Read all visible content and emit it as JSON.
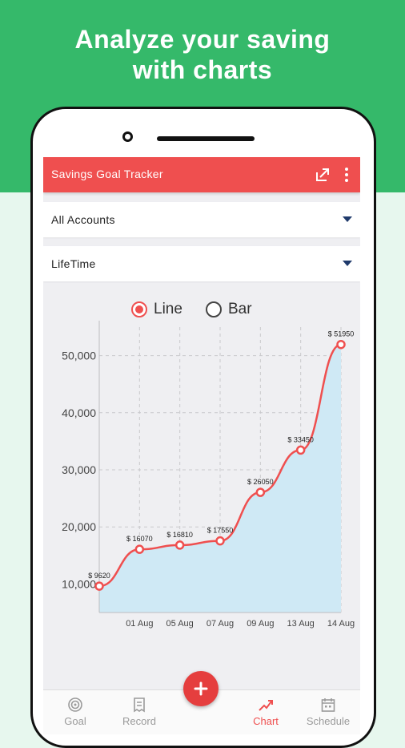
{
  "hero": {
    "line1": "Analyze your saving",
    "line2": "with charts"
  },
  "app_bar": {
    "title": "Savings Goal Tracker",
    "share_icon": "share-icon",
    "menu_icon": "more-vert-icon"
  },
  "filters": {
    "account": {
      "value": "All Accounts",
      "icon": "dropdown-arrow-icon"
    },
    "period": {
      "value": "LifeTime",
      "icon": "dropdown-arrow-icon"
    }
  },
  "chart_toggle": {
    "options": [
      {
        "label": "Line",
        "selected": true
      },
      {
        "label": "Bar",
        "selected": false
      }
    ]
  },
  "chart_data": {
    "type": "line",
    "x": [
      "",
      "01 Aug",
      "05 Aug",
      "07 Aug",
      "09 Aug",
      "13 Aug",
      "14 Aug"
    ],
    "values": [
      9620,
      16070,
      16810,
      17550,
      26050,
      33450,
      51950
    ],
    "labels": [
      "$ 9620",
      "$ 16070",
      "$ 16810",
      "$ 17550",
      "$ 26050",
      "$ 33450",
      "$ 51950"
    ],
    "y_ticks": [
      "10,000",
      "20,000",
      "30,000",
      "40,000",
      "50,000"
    ],
    "ylim": [
      5000,
      55000
    ],
    "grid": true,
    "line_color": "#ef4f4f",
    "fill_color": "#cfe9f5"
  },
  "fab": {
    "icon": "plus-icon"
  },
  "bottom_nav": {
    "items": [
      {
        "label": "Goal",
        "icon": "target-icon",
        "active": false
      },
      {
        "label": "Record",
        "icon": "receipt-icon",
        "active": false
      },
      {
        "label": "Chart",
        "icon": "trend-chart-icon",
        "active": true
      },
      {
        "label": "Schedule",
        "icon": "calendar-icon",
        "active": false
      }
    ]
  },
  "colors": {
    "hero": "#35b96a",
    "accent": "#ef4f4f",
    "background": "#e7f7ee"
  }
}
